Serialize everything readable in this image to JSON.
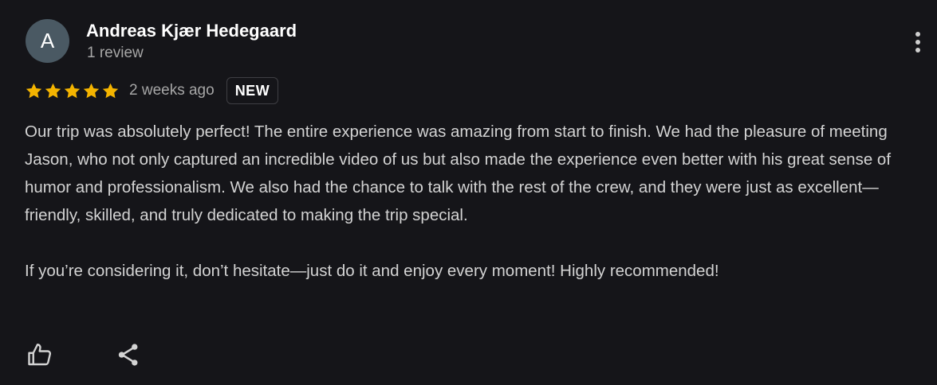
{
  "review": {
    "avatar_letter": "A",
    "author_name": "Andreas Kjær Hedegaard",
    "review_count": "1 review",
    "rating": 5,
    "rating_max": 5,
    "date": "2 weeks ago",
    "badge": "NEW",
    "paragraphs": [
      "Our trip was absolutely perfect! The entire experience was amazing from start to finish. We had the pleasure of meeting Jason, who not only captured an incredible video of us but also made the experience even better with his great sense of humor and professionalism. We also had the chance to talk with the rest of the crew, and they were just as excellent—friendly, skilled, and truly dedicated to making the trip special.",
      "If you’re considering it, don’t hesitate—just do it and enjoy every moment! Highly recommended!"
    ]
  },
  "icons": {
    "star": "star-icon",
    "like": "thumbs-up-icon",
    "share": "share-icon",
    "more": "more-vertical-icon"
  },
  "colors": {
    "background": "#151519",
    "star": "#f4b400",
    "avatar": "#4a5963",
    "primary_text": "#ffffff",
    "secondary_text": "#a6a6a6",
    "body_text": "#d3d3d3"
  }
}
